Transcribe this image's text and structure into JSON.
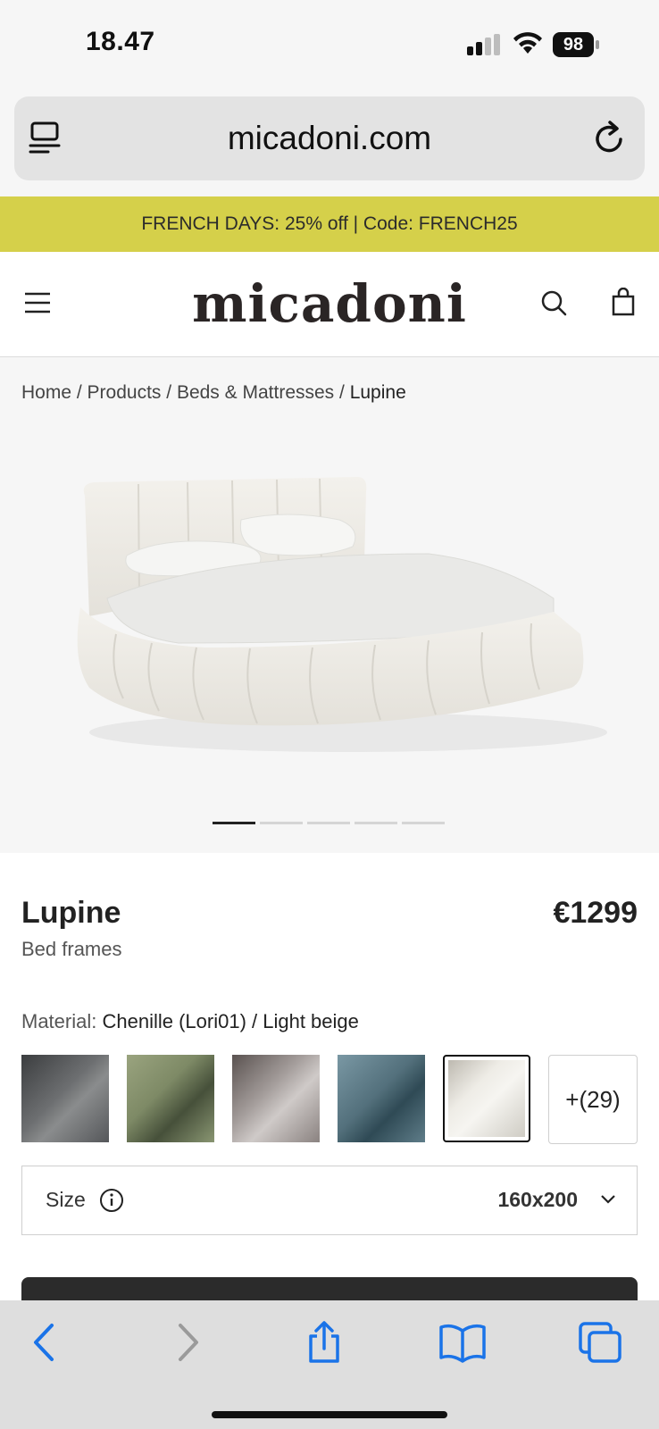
{
  "status_bar": {
    "time": "18.47",
    "battery": "98"
  },
  "address_bar": {
    "url": "micadoni.com"
  },
  "promo": {
    "text": "FRENCH DAYS: 25% off | Code: FRENCH25",
    "color": "#d5d04a"
  },
  "header": {
    "logo_text": "micadoni"
  },
  "breadcrumb": {
    "items": [
      "Home",
      "Products",
      "Beds & Mattresses",
      "Lupine"
    ]
  },
  "carousel": {
    "total_slides": 5,
    "active_slide": 1
  },
  "product": {
    "name": "Lupine",
    "category": "Bed frames",
    "price": "€1299",
    "material_label": "Material:",
    "material_value": "Chenille (Lori01) / Light beige",
    "swatches": [
      {
        "name": "dark grey",
        "color": "#5f6163"
      },
      {
        "name": "sage green",
        "color": "#7e8a66"
      },
      {
        "name": "taupe",
        "color": "#9a9290"
      },
      {
        "name": "petrol blue",
        "color": "#53707c"
      },
      {
        "name": "light beige",
        "color": "#dcdad2",
        "selected": true
      }
    ],
    "more_swatches": "+(29)",
    "size_label": "Size",
    "size_value": "160x200"
  },
  "toolbar": {
    "icons": [
      "back-icon",
      "forward-icon",
      "share-icon",
      "bookmarks-icon",
      "tabs-icon"
    ],
    "accent": "#1a73e8"
  }
}
